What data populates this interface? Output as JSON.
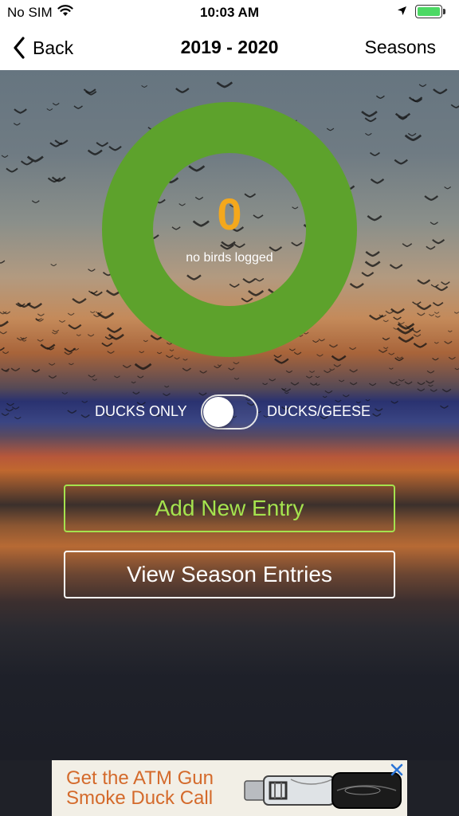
{
  "status_bar": {
    "carrier": "No SIM",
    "time": "10:03 AM",
    "battery_level": 1.0,
    "battery_color": "#4cd964"
  },
  "nav": {
    "back_label": "Back",
    "title": "2019 - 2020",
    "right_label": "Seasons"
  },
  "summary": {
    "bird_count": "0",
    "caption": "no birds logged",
    "ring_color": "#5da22c",
    "count_color": "#f4a81c"
  },
  "toggle": {
    "left_label": "DUCKS ONLY",
    "right_label": "DUCKS/GEESE",
    "on": false
  },
  "actions": {
    "add_entry": "Add New Entry",
    "view_entries": "View Season Entries",
    "add_color": "#a5e34e"
  },
  "ad": {
    "line1": "Get the ATM Gun",
    "line2": "Smoke Duck Call",
    "text_color": "#d46a2b",
    "icons": [
      "close-icon",
      "duck-call-image"
    ]
  }
}
